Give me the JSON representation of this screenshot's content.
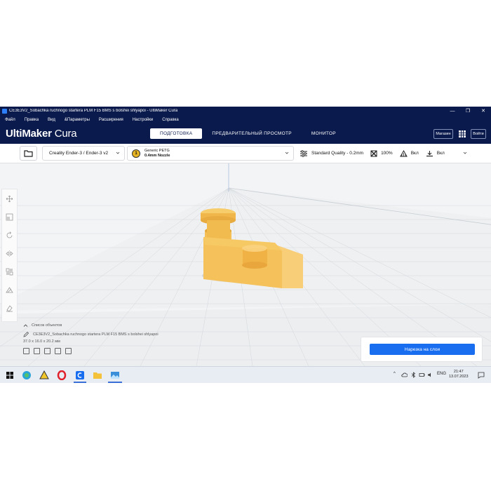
{
  "window": {
    "title": "CE3E3V2_Sobachka ruchnogo startera PLM F15 BMS s bolshei shlyapoi - UltiMaker Cura",
    "controls": [
      "minimize-icon",
      "restore-icon",
      "close-icon"
    ]
  },
  "menu": [
    "Файл",
    "Правка",
    "Вид",
    "&Параметры",
    "Расширения",
    "Настройки",
    "Справка"
  ],
  "header": {
    "logo_bold": "UltiMaker",
    "logo_light": " Cura",
    "tabs": [
      "ПОДГОТОВКА",
      "ПРЕДВАРИТЕЛЬНЫЙ ПРОСМОТР",
      "МОНИТОР"
    ],
    "active_tab": "ПОДГОТОВКА",
    "market": "Магазин",
    "signin": "Войти"
  },
  "toolbar": {
    "printer": "Creality Ender-3 / Ender-3 v2",
    "material": "Generic PETG",
    "nozzle": "0.4mm Nozzle",
    "material_badge": "1",
    "quality": "Standard Quality - 0.2mm",
    "infill": "100%",
    "support": "Вкл",
    "adhesion": "Вкл"
  },
  "objects": {
    "header": "Список объектов",
    "filename": "CE3E3V2_Sobachka ruchnogo startera PLM F15 BMS s bolshei shlyapoi",
    "dimensions": "37.0 x 16.0 x 20.2 мм"
  },
  "slice_button": "Нарезка на слои",
  "taskbar": {
    "language": "ENG",
    "time": "21:47",
    "date": "13.07.2023"
  },
  "colors": {
    "header_bg": "#0b1a4c",
    "accent": "#196ef0",
    "model": "#f2bb4f"
  }
}
